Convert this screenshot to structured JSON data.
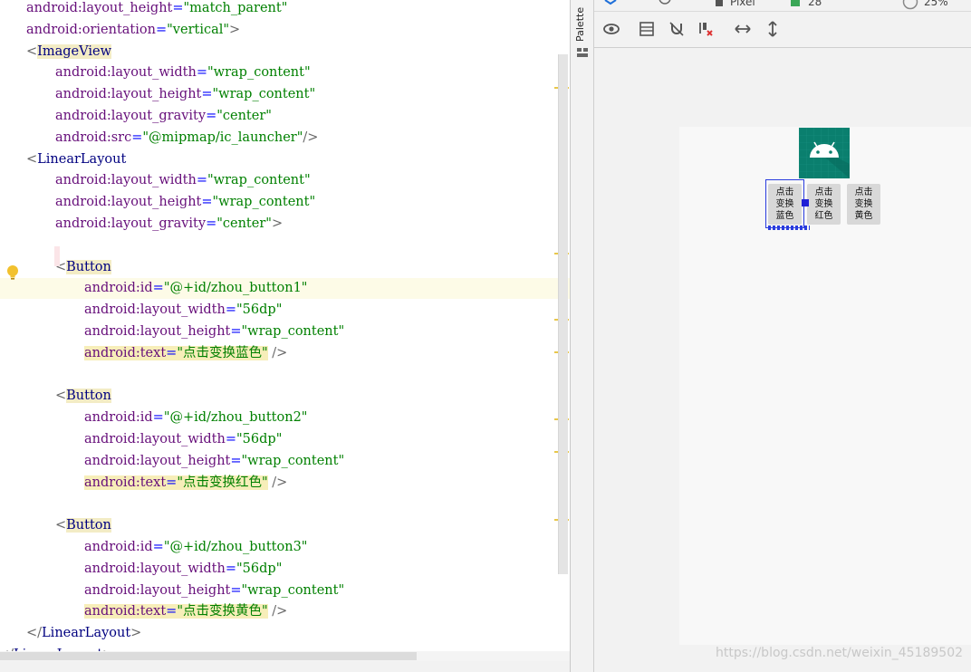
{
  "editor": {
    "lines": [
      {
        "indent": 0,
        "tokens": [
          [
            "attr",
            "android:layout_height"
          ],
          [
            "eq",
            "="
          ],
          [
            "str",
            "\"match_parent\""
          ]
        ]
      },
      {
        "indent": 0,
        "tokens": [
          [
            "attr",
            "android:orientation"
          ],
          [
            "eq",
            "="
          ],
          [
            "str",
            "\"vertical\""
          ],
          [
            "angle",
            ">"
          ]
        ]
      },
      {
        "indent": 0,
        "tokens": [
          [
            "angle",
            "<"
          ],
          [
            "tagname-hl",
            "ImageView"
          ]
        ]
      },
      {
        "indent": 1,
        "tokens": [
          [
            "attr",
            "android:layout_width"
          ],
          [
            "eq",
            "="
          ],
          [
            "str",
            "\"wrap_content\""
          ]
        ]
      },
      {
        "indent": 1,
        "tokens": [
          [
            "attr",
            "android:layout_height"
          ],
          [
            "eq",
            "="
          ],
          [
            "str",
            "\"wrap_content\""
          ]
        ]
      },
      {
        "indent": 1,
        "tokens": [
          [
            "attr",
            "android:layout_gravity"
          ],
          [
            "eq",
            "="
          ],
          [
            "str",
            "\"center\""
          ]
        ]
      },
      {
        "indent": 1,
        "tokens": [
          [
            "attr",
            "android:src"
          ],
          [
            "eq",
            "="
          ],
          [
            "str",
            "\"@mipmap/ic_launcher\""
          ],
          [
            "angle",
            "/>"
          ]
        ]
      },
      {
        "indent": 0,
        "tokens": [
          [
            "angle",
            "<"
          ],
          [
            "tagname",
            "LinearLayout"
          ]
        ]
      },
      {
        "indent": 1,
        "tokens": [
          [
            "attr",
            "android:layout_width"
          ],
          [
            "eq",
            "="
          ],
          [
            "str",
            "\"wrap_content\""
          ]
        ]
      },
      {
        "indent": 1,
        "tokens": [
          [
            "attr",
            "android:layout_height"
          ],
          [
            "eq",
            "="
          ],
          [
            "str",
            "\"wrap_content\""
          ]
        ]
      },
      {
        "indent": 1,
        "tokens": [
          [
            "attr",
            "android:layout_gravity"
          ],
          [
            "eq",
            "="
          ],
          [
            "str",
            "\"center\""
          ],
          [
            "angle",
            ">"
          ]
        ]
      },
      {
        "indent": 0,
        "tokens": []
      },
      {
        "indent": 1,
        "tokens": [
          [
            "angle",
            "<"
          ],
          [
            "tagname-hl",
            "Button"
          ]
        ]
      },
      {
        "indent": 2,
        "tokens": [
          [
            "attr",
            "android:id"
          ],
          [
            "eq",
            "="
          ],
          [
            "str",
            "\"@+id/zhou_button1\""
          ]
        ],
        "active": true
      },
      {
        "indent": 2,
        "tokens": [
          [
            "attr",
            "android:layout_width"
          ],
          [
            "eq",
            "="
          ],
          [
            "str",
            "\"56dp\""
          ]
        ]
      },
      {
        "indent": 2,
        "tokens": [
          [
            "attr",
            "android:layout_height"
          ],
          [
            "eq",
            "="
          ],
          [
            "str",
            "\"wrap_content\""
          ]
        ]
      },
      {
        "indent": 2,
        "tokens": [
          [
            "attr-hl",
            "android:text"
          ],
          [
            "eq-hl",
            "="
          ],
          [
            "str-hl",
            "\"点击变换蓝色\""
          ],
          [
            "angle",
            " />"
          ]
        ]
      },
      {
        "indent": 0,
        "tokens": []
      },
      {
        "indent": 1,
        "tokens": [
          [
            "angle",
            "<"
          ],
          [
            "tagname-hl",
            "Button"
          ]
        ]
      },
      {
        "indent": 2,
        "tokens": [
          [
            "attr",
            "android:id"
          ],
          [
            "eq",
            "="
          ],
          [
            "str",
            "\"@+id/zhou_button2\""
          ]
        ]
      },
      {
        "indent": 2,
        "tokens": [
          [
            "attr",
            "android:layout_width"
          ],
          [
            "eq",
            "="
          ],
          [
            "str",
            "\"56dp\""
          ]
        ]
      },
      {
        "indent": 2,
        "tokens": [
          [
            "attr",
            "android:layout_height"
          ],
          [
            "eq",
            "="
          ],
          [
            "str",
            "\"wrap_content\""
          ]
        ]
      },
      {
        "indent": 2,
        "tokens": [
          [
            "attr-hl",
            "android:text"
          ],
          [
            "eq-hl",
            "="
          ],
          [
            "str-hl",
            "\"点击变换红色\""
          ],
          [
            "angle",
            " />"
          ]
        ]
      },
      {
        "indent": 0,
        "tokens": []
      },
      {
        "indent": 1,
        "tokens": [
          [
            "angle",
            "<"
          ],
          [
            "tagname-hl",
            "Button"
          ]
        ]
      },
      {
        "indent": 2,
        "tokens": [
          [
            "attr",
            "android:id"
          ],
          [
            "eq",
            "="
          ],
          [
            "str",
            "\"@+id/zhou_button3\""
          ]
        ]
      },
      {
        "indent": 2,
        "tokens": [
          [
            "attr",
            "android:layout_width"
          ],
          [
            "eq",
            "="
          ],
          [
            "str",
            "\"56dp\""
          ]
        ]
      },
      {
        "indent": 2,
        "tokens": [
          [
            "attr",
            "android:layout_height"
          ],
          [
            "eq",
            "="
          ],
          [
            "str",
            "\"wrap_content\""
          ]
        ]
      },
      {
        "indent": 2,
        "tokens": [
          [
            "attr-hl",
            "android:text"
          ],
          [
            "eq-hl",
            "="
          ],
          [
            "str-hl",
            "\"点击变换黄色\""
          ],
          [
            "angle",
            " />"
          ]
        ]
      },
      {
        "indent": 0,
        "tokens": [
          [
            "angle",
            "</"
          ],
          [
            "tagname",
            "LinearLayout"
          ],
          [
            "angle",
            ">"
          ]
        ]
      },
      {
        "indent": -1,
        "tokens": [
          [
            "angle",
            "</"
          ],
          [
            "tagname",
            "LinearLayout"
          ],
          [
            "angle",
            ">"
          ]
        ]
      }
    ]
  },
  "palette": {
    "label": "Palette"
  },
  "toolbar_top": {
    "device": "Pixel",
    "api": "28",
    "zoom": "25%"
  },
  "toolbar": {
    "icons": [
      "eye-icon",
      "blueprint-icon",
      "magnet-off-icon",
      "clear-constraints-icon",
      "expand-horizontal-icon",
      "expand-vertical-icon"
    ]
  },
  "preview": {
    "buttons": [
      {
        "label": "点击\n变换\n蓝色"
      },
      {
        "label": "点击\n变换\n红色"
      },
      {
        "label": "点击\n变换\n黄色"
      }
    ]
  },
  "watermark": "https://blog.csdn.net/weixin_45189502",
  "colors": {
    "tag": "#000080",
    "attr": "#660e7a",
    "string": "#008000",
    "highlight": "#f7eeb9",
    "logo_bg": "#0a7f6e"
  }
}
